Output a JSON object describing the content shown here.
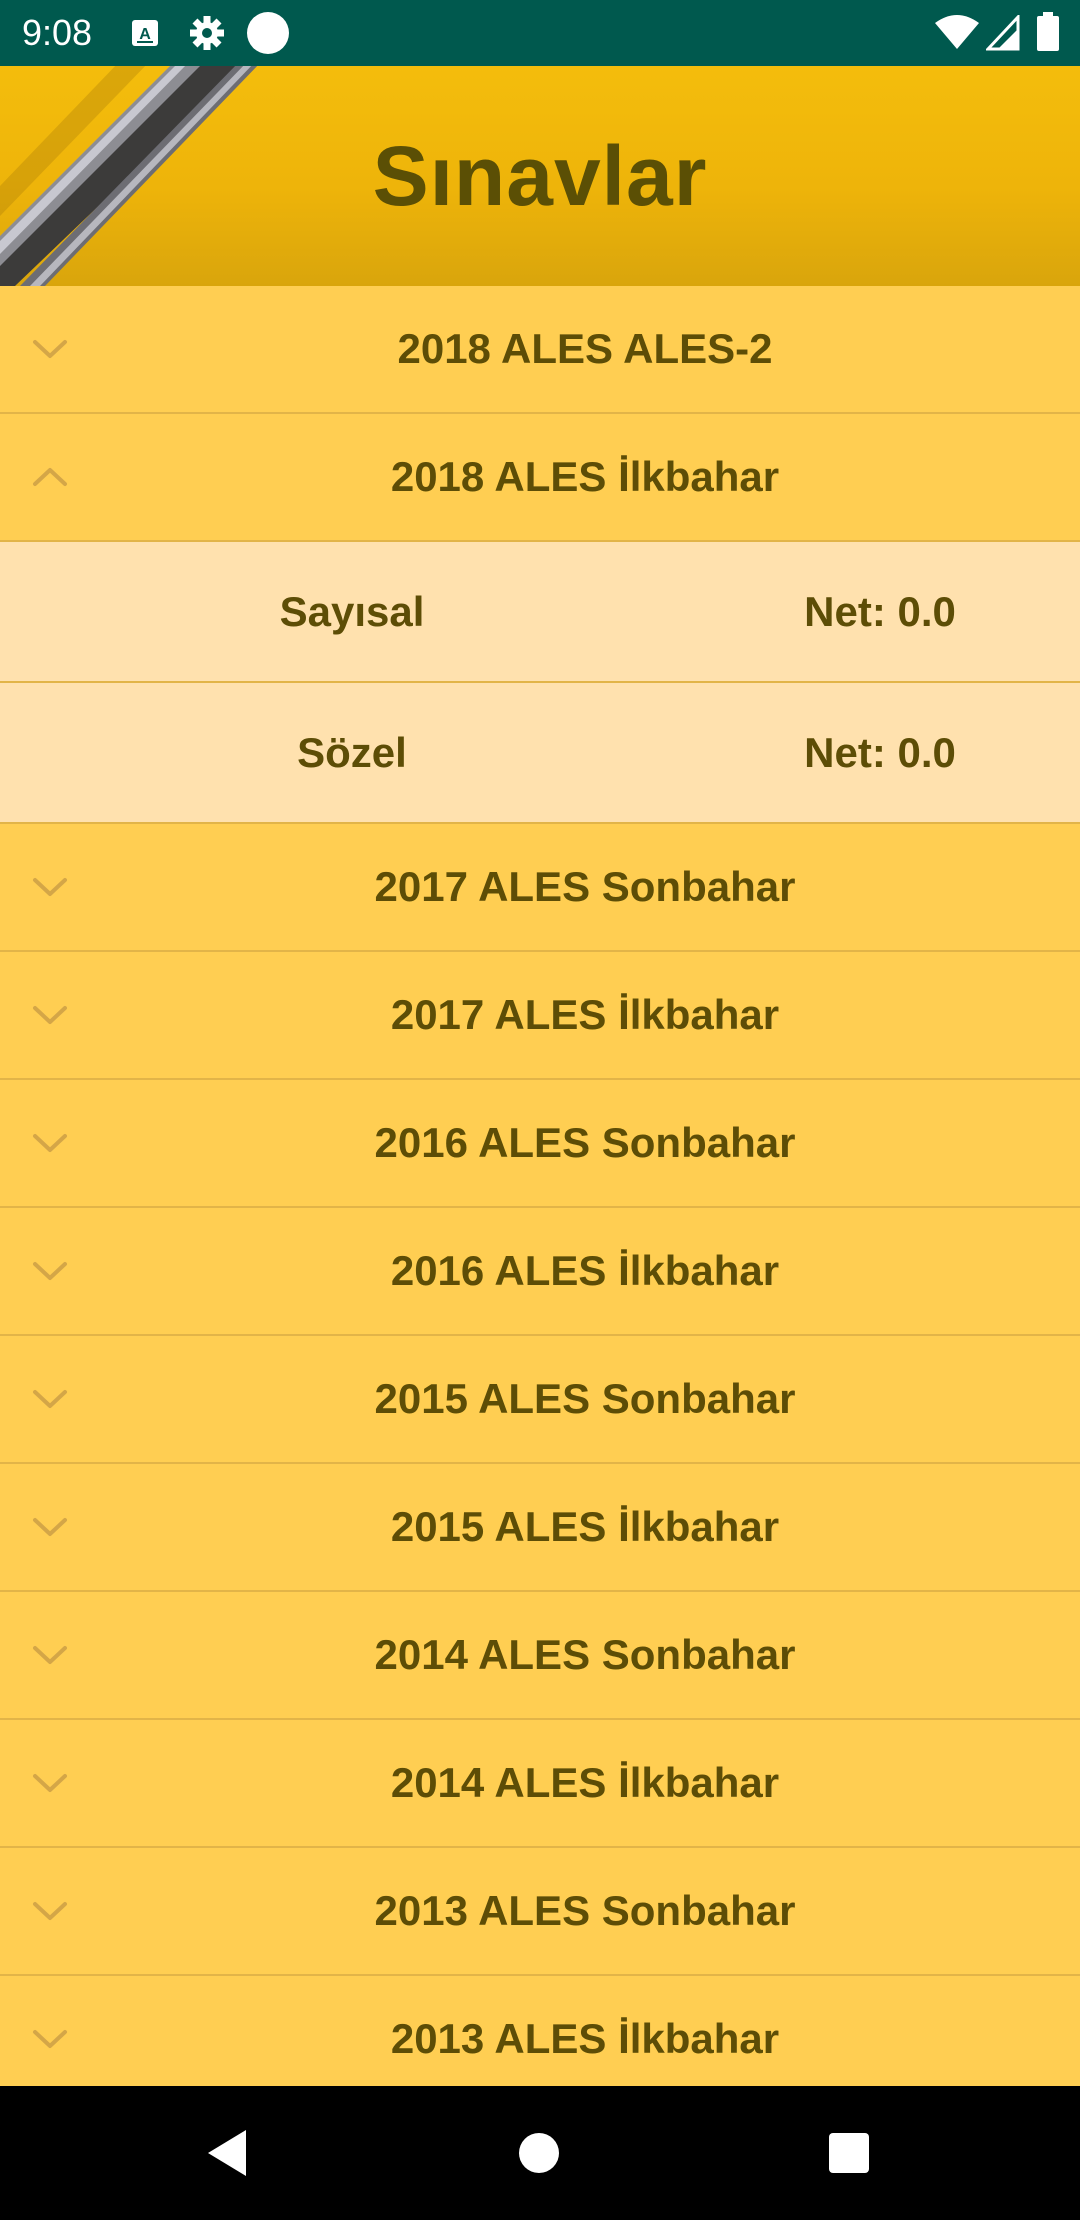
{
  "status_bar": {
    "time": "9:08",
    "left_icons": [
      "keyboard-a-icon",
      "gear-icon",
      "circle-notification-icon"
    ],
    "right_icons": [
      "wifi-icon",
      "cell-signal-icon",
      "battery-icon"
    ],
    "background": "#00594e"
  },
  "header": {
    "title": "Sınavlar",
    "background": "#f0b80b",
    "title_color": "#5b4f05"
  },
  "exams": [
    {
      "title": "2018 ALES ALES-2",
      "expanded": false,
      "icon": "chevron-down-icon"
    },
    {
      "title": "2018 ALES İlkbahar",
      "expanded": true,
      "icon": "chevron-up-icon",
      "sections": [
        {
          "name": "Sayısal",
          "net": "Net: 0.0"
        },
        {
          "name": "Sözel",
          "net": "Net: 0.0"
        }
      ]
    },
    {
      "title": "2017 ALES Sonbahar",
      "expanded": false,
      "icon": "chevron-down-icon"
    },
    {
      "title": "2017 ALES İlkbahar",
      "expanded": false,
      "icon": "chevron-down-icon"
    },
    {
      "title": "2016 ALES Sonbahar",
      "expanded": false,
      "icon": "chevron-down-icon"
    },
    {
      "title": "2016 ALES İlkbahar",
      "expanded": false,
      "icon": "chevron-down-icon"
    },
    {
      "title": "2015 ALES Sonbahar",
      "expanded": false,
      "icon": "chevron-down-icon"
    },
    {
      "title": "2015 ALES İlkbahar",
      "expanded": false,
      "icon": "chevron-down-icon"
    },
    {
      "title": "2014 ALES Sonbahar",
      "expanded": false,
      "icon": "chevron-down-icon"
    },
    {
      "title": "2014 ALES İlkbahar",
      "expanded": false,
      "icon": "chevron-down-icon"
    },
    {
      "title": "2013 ALES Sonbahar",
      "expanded": false,
      "icon": "chevron-down-icon"
    },
    {
      "title": "2013 ALES İlkbahar",
      "expanded": false,
      "icon": "chevron-down-icon"
    }
  ],
  "colors": {
    "row_background": "#ffce52",
    "subrow_background": "#ffe1ae",
    "text": "#5d4d06",
    "divider": "#e2b448"
  },
  "nav_bar": {
    "buttons": [
      "back-icon",
      "home-icon",
      "recents-icon"
    ]
  }
}
